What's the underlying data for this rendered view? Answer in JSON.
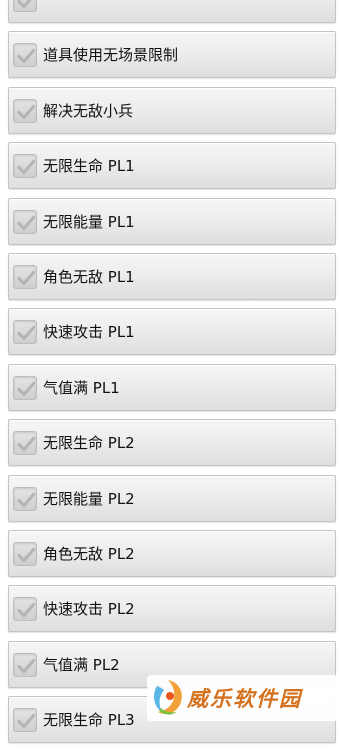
{
  "cheat_list": {
    "items": [
      {
        "label": "",
        "checked": false
      },
      {
        "label": "道具使用无场景限制",
        "checked": false
      },
      {
        "label": "解决无敌小兵",
        "checked": false
      },
      {
        "label": "无限生命 PL1",
        "checked": false
      },
      {
        "label": "无限能量 PL1",
        "checked": false
      },
      {
        "label": "角色无敌 PL1",
        "checked": false
      },
      {
        "label": "快速攻击 PL1",
        "checked": false
      },
      {
        "label": "气值满 PL1",
        "checked": false
      },
      {
        "label": "无限生命 PL2",
        "checked": false
      },
      {
        "label": "无限能量 PL2",
        "checked": false
      },
      {
        "label": "角色无敌 PL2",
        "checked": false
      },
      {
        "label": "快速攻击 PL2",
        "checked": false
      },
      {
        "label": "气值满 PL2",
        "checked": false
      },
      {
        "label": "无限生命 PL3",
        "checked": false
      }
    ]
  },
  "watermark": {
    "text": "威乐软件园",
    "color": "#d4721f"
  },
  "colors": {
    "row_top": "#f6f6f6",
    "row_bottom": "#dedede",
    "checkbox_fill": "#cfcfcf",
    "checkmark": "#b5b5b5"
  }
}
